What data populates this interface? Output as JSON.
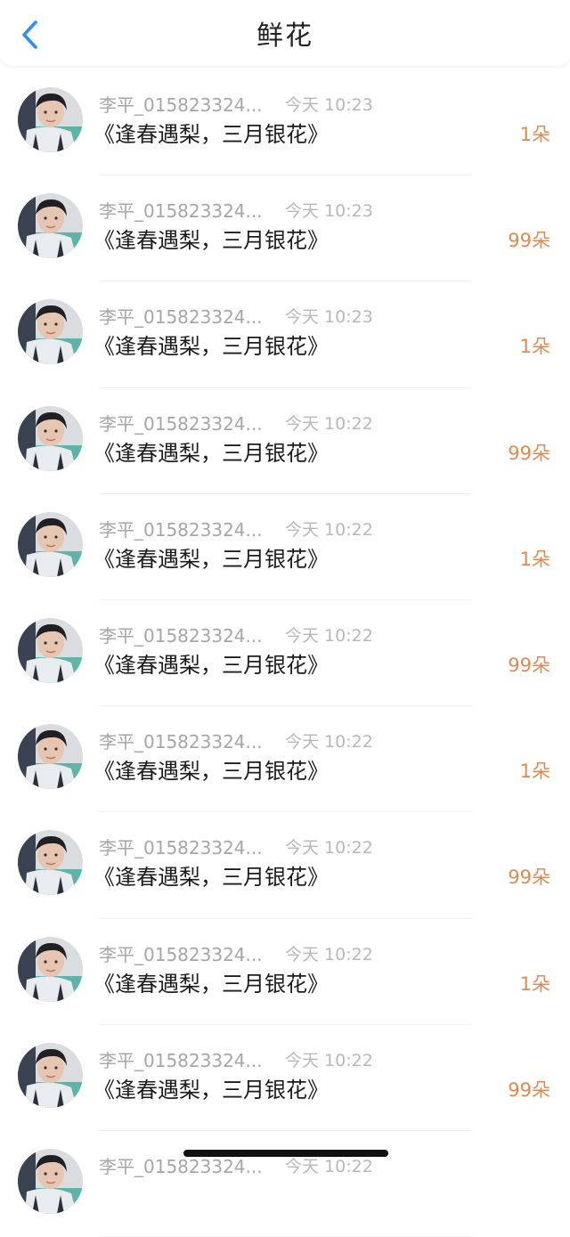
{
  "header": {
    "title": "鲜花",
    "back_icon": "chevron-left-icon",
    "accent_color": "#2e8ff0"
  },
  "colors": {
    "name": "#a6a6a6",
    "time": "#b8b8b8",
    "gift": "#1c1c1c",
    "count": "#e08a4d"
  },
  "items": [
    {
      "name": "李平_015823324...",
      "time": "今天 10:23",
      "gift": "《逢春遇梨，三月银花》",
      "count": "1朵"
    },
    {
      "name": "李平_015823324...",
      "time": "今天 10:23",
      "gift": "《逢春遇梨，三月银花》",
      "count": "99朵"
    },
    {
      "name": "李平_015823324...",
      "time": "今天 10:23",
      "gift": "《逢春遇梨，三月银花》",
      "count": "1朵"
    },
    {
      "name": "李平_015823324...",
      "time": "今天 10:22",
      "gift": "《逢春遇梨，三月银花》",
      "count": "99朵"
    },
    {
      "name": "李平_015823324...",
      "time": "今天 10:22",
      "gift": "《逢春遇梨，三月银花》",
      "count": "1朵"
    },
    {
      "name": "李平_015823324...",
      "time": "今天 10:22",
      "gift": "《逢春遇梨，三月银花》",
      "count": "99朵"
    },
    {
      "name": "李平_015823324...",
      "time": "今天 10:22",
      "gift": "《逢春遇梨，三月银花》",
      "count": "1朵"
    },
    {
      "name": "李平_015823324...",
      "time": "今天 10:22",
      "gift": "《逢春遇梨，三月银花》",
      "count": "99朵"
    },
    {
      "name": "李平_015823324...",
      "time": "今天 10:22",
      "gift": "《逢春遇梨，三月银花》",
      "count": "1朵"
    },
    {
      "name": "李平_015823324...",
      "time": "今天 10:22",
      "gift": "《逢春遇梨，三月银花》",
      "count": "99朵"
    },
    {
      "name": "李平_015823324...",
      "time": "今天 10:22",
      "gift": "",
      "count": ""
    }
  ]
}
